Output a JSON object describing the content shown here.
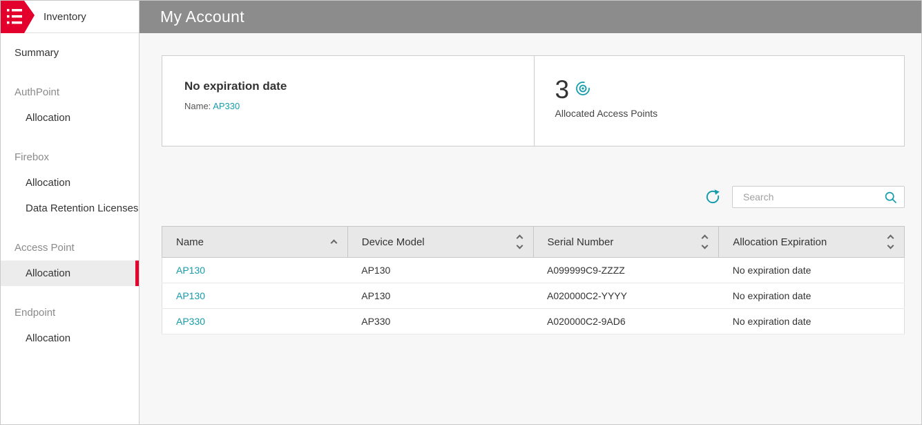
{
  "sidebar": {
    "brand_label": "Inventory",
    "items": [
      {
        "label": "Summary"
      },
      {
        "label": "AuthPoint"
      },
      {
        "label": "Allocation"
      },
      {
        "label": "Firebox"
      },
      {
        "label": "Allocation"
      },
      {
        "label": "Data Retention Licenses"
      },
      {
        "label": "Access Point"
      },
      {
        "label": "Allocation",
        "selected": true
      },
      {
        "label": "Endpoint"
      },
      {
        "label": "Allocation"
      }
    ]
  },
  "header": {
    "title": "My Account"
  },
  "cards": {
    "expiration": {
      "title": "No expiration date",
      "name_label": "Name:",
      "name_value": "AP330"
    },
    "allocated": {
      "count": "3",
      "label": "Allocated Access Points"
    }
  },
  "toolbar": {
    "search_placeholder": "Search"
  },
  "table": {
    "columns": [
      {
        "label": "Name",
        "sort": "asc"
      },
      {
        "label": "Device Model",
        "sort": "both"
      },
      {
        "label": "Serial Number",
        "sort": "both"
      },
      {
        "label": "Allocation Expiration",
        "sort": "both"
      }
    ],
    "rows": [
      {
        "name": "AP130",
        "device_model": "AP130",
        "serial_number": "A099999C9-ZZZZ",
        "allocation_expiration": "No expiration date"
      },
      {
        "name": "AP130",
        "device_model": "AP130",
        "serial_number": "A020000C2-YYYY",
        "allocation_expiration": "No expiration date"
      },
      {
        "name": "AP330",
        "device_model": "AP330",
        "serial_number": "A020000C2-9AD6",
        "allocation_expiration": "No expiration date"
      }
    ]
  },
  "colors": {
    "accent_teal": "#149cab",
    "brand_red": "#e3002c",
    "header_gray": "#8c8c8c"
  }
}
